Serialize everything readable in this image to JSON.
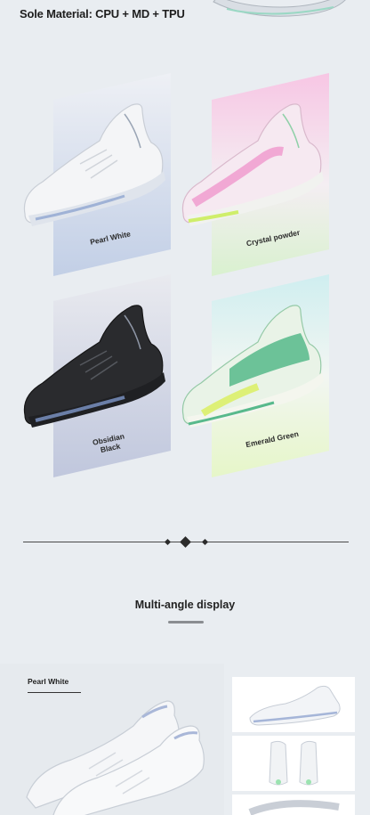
{
  "header": {
    "sole_material": "Sole Material: CPU + MD + TPU"
  },
  "colors": [
    {
      "label": "Pearl White",
      "accent": "#b9c7e2"
    },
    {
      "label": "Crystal powder",
      "accent": "#f2a9d6"
    },
    {
      "label": "Obsidian\nBlack",
      "accent": "#b8c0d6"
    },
    {
      "label": "Emerald Green",
      "accent": "#bfe6d6"
    }
  ],
  "section": {
    "title": "Multi-angle display"
  },
  "gallery": {
    "main_label": "Pearl White"
  }
}
